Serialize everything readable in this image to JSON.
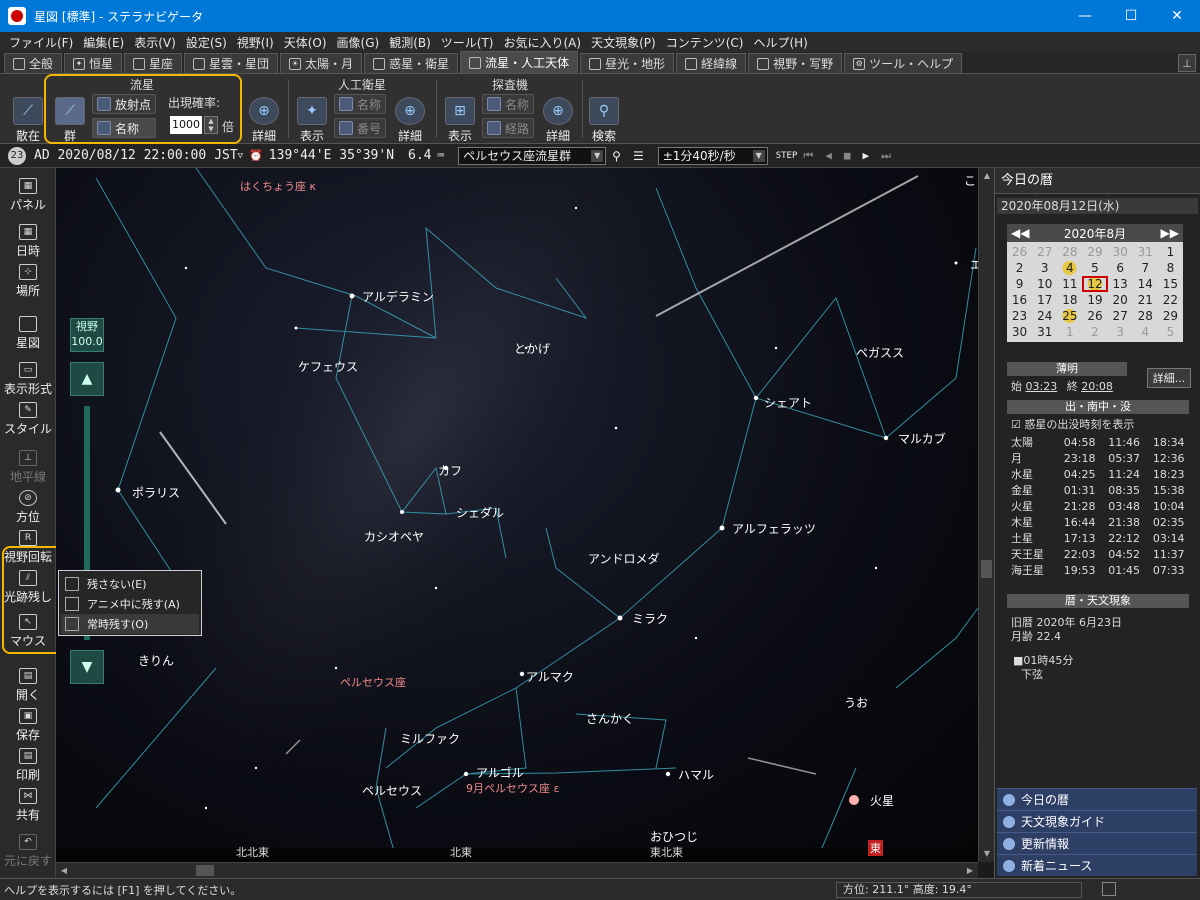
{
  "window": {
    "title": "星図 [標準] - ステラナビゲータ"
  },
  "menu": [
    "ファイル(F)",
    "編集(E)",
    "表示(V)",
    "設定(S)",
    "視野(I)",
    "天体(O)",
    "画像(G)",
    "観測(B)",
    "ツール(T)",
    "お気に入り(A)",
    "天文現象(P)",
    "コンテンツ(C)",
    "ヘルプ(H)"
  ],
  "tabs": [
    {
      "label": "全般",
      "icon": "panel-icon"
    },
    {
      "label": "恒星",
      "icon": "star-icon"
    },
    {
      "label": "星座",
      "icon": "constellation-icon"
    },
    {
      "label": "星雲・星団",
      "icon": "nebula-icon"
    },
    {
      "label": "太陽・月",
      "icon": "sun-icon"
    },
    {
      "label": "惑星・衛星",
      "icon": "planet-icon"
    },
    {
      "label": "流星・人工天体",
      "icon": "meteor-icon",
      "active": true
    },
    {
      "label": "昼光・地形",
      "icon": "daylight-icon"
    },
    {
      "label": "経緯線",
      "icon": "grid-icon"
    },
    {
      "label": "視野・写野",
      "icon": "fov-icon"
    },
    {
      "label": "ツール・ヘルプ",
      "icon": "gear-icon"
    }
  ],
  "ribbon": {
    "meteor_title": "流星",
    "sporadic": "散在",
    "shower": "群",
    "radiant": "放射点",
    "name": "名称",
    "rate_label": "出現確率:",
    "rate_value": "1000",
    "rate_unit": "倍",
    "detail": "詳細",
    "satellite_title": "人工衛星",
    "sat_show": "表示",
    "sat_name": "名称",
    "sat_number": "番号",
    "sat_detail": "詳細",
    "probe_title": "探査機",
    "probe_show": "表示",
    "probe_name": "名称",
    "probe_path": "経路",
    "probe_detail": "詳細",
    "search": "検索"
  },
  "statusrow": {
    "day": "23",
    "datetime": "AD 2020/08/12 22:00:00",
    "tz": "JST",
    "coords": "139°44'E 35°39'N",
    "mag": "6.4",
    "target": "ペルセウス座流星群",
    "speed": "±1分40秒/秒"
  },
  "lefttool": [
    {
      "label": "パネル",
      "icon": "panel-icon"
    },
    {
      "label": "日時",
      "icon": "calendar-icon"
    },
    {
      "label": "場所",
      "icon": "location-icon"
    },
    {
      "label": "星図",
      "icon": "starmap-icon"
    },
    {
      "label": "表示形式",
      "icon": "display-icon"
    },
    {
      "label": "スタイル",
      "icon": "style-icon"
    },
    {
      "label": "地平線",
      "icon": "horizon-icon",
      "disabled": true
    },
    {
      "label": "方位",
      "icon": "compass-icon"
    },
    {
      "label": "視野回転",
      "icon": "rotate-icon"
    },
    {
      "label": "光跡残し",
      "icon": "trail-icon"
    },
    {
      "label": "マウス",
      "icon": "mouse-icon"
    },
    {
      "label": "開く",
      "icon": "open-icon"
    },
    {
      "label": "保存",
      "icon": "save-icon"
    },
    {
      "label": "印刷",
      "icon": "print-icon"
    },
    {
      "label": "共有",
      "icon": "share-icon"
    },
    {
      "label": "元に戻す",
      "icon": "undo-icon",
      "disabled": true
    }
  ],
  "zoom": {
    "label": "視野",
    "value": "100.0"
  },
  "popup": [
    {
      "label": "残さない(E)",
      "icon": "no-trail-icon"
    },
    {
      "label": "アニメ中に残す(A)",
      "icon": "anim-trail-icon"
    },
    {
      "label": "常時残す(O)",
      "icon": "always-trail-icon"
    }
  ],
  "sky": {
    "labels": {
      "cygnus_kappa": "はくちょう座 κ",
      "alderamin": "アルデラミン",
      "cepheus": "ケフェウス",
      "lacerta": "とかげ",
      "pegasus": "ペガスス",
      "scheat": "シェアト",
      "markab": "マルカブ",
      "polaris": "ポラリス",
      "caph": "カフ",
      "schedar": "シェダル",
      "cassiopeia": "カシオペヤ",
      "alpheratz": "アルフェラッツ",
      "andromeda": "アンドロメダ",
      "mirach": "ミラク",
      "perseus_radiant": "ペルセウス座",
      "almach": "アルマク",
      "triangulum": "さんかく",
      "mirfak": "ミルファク",
      "algol": "アルゴル",
      "sep_perseids": "9月ペルセウス座 ε",
      "perseus": "ペルセウス",
      "hamal": "ハマル",
      "aries": "おひつじ",
      "pisces": "うお",
      "mars": "火星",
      "camelopardalis": "きりん",
      "n_ne": "北北東",
      "ne": "北東",
      "ene": "東北東",
      "east": "東",
      "e_edge": "エ",
      "ko_edge": "こ"
    }
  },
  "today": {
    "title": "今日の暦",
    "date": "2020年08月12日(水)",
    "calendar_title": "2020年8月",
    "days": [
      "26",
      "27",
      "28",
      "29",
      "30",
      "31",
      "1",
      "2",
      "3",
      "4",
      "5",
      "6",
      "7",
      "8",
      "9",
      "10",
      "11",
      "12",
      "13",
      "14",
      "15",
      "16",
      "17",
      "18",
      "19",
      "20",
      "21",
      "22",
      "23",
      "24",
      "25",
      "26",
      "27",
      "28",
      "29",
      "30",
      "31",
      "1",
      "2",
      "3",
      "4",
      "5"
    ],
    "twilight_title": "薄明",
    "twilight_start_label": "始",
    "twilight_start": "03:23",
    "twilight_end_label": "終",
    "twilight_end": "20:08",
    "detail_btn": "詳細...",
    "riseset_title": "出・南中・没",
    "riseset_check": "惑星の出没時刻を表示",
    "planets": [
      [
        "太陽",
        "04:58",
        "11:46",
        "18:34"
      ],
      [
        "月",
        "23:18",
        "05:37",
        "12:36"
      ],
      [
        "水星",
        "04:25",
        "11:24",
        "18:23"
      ],
      [
        "金星",
        "01:31",
        "08:35",
        "15:38"
      ],
      [
        "火星",
        "21:28",
        "03:48",
        "10:04"
      ],
      [
        "木星",
        "16:44",
        "21:38",
        "02:35"
      ],
      [
        "土星",
        "17:13",
        "22:12",
        "03:14"
      ],
      [
        "天王星",
        "22:03",
        "04:52",
        "11:37"
      ],
      [
        "海王星",
        "19:53",
        "01:45",
        "07:33"
      ]
    ],
    "calendar_section": "暦・天文現象",
    "lunar": "旧暦 2020年 6月23日",
    "moon_age": "月齢 22.4",
    "phase_time": "■01時45分",
    "phase_name": "下弦"
  },
  "links": [
    "今日の暦",
    "天文現象ガイド",
    "更新情報",
    "新着ニュース"
  ],
  "statusbar": {
    "help": "ヘルプを表示するには [F1] を押してください。",
    "coords": "方位: 211.1° 高度: 19.4°"
  }
}
